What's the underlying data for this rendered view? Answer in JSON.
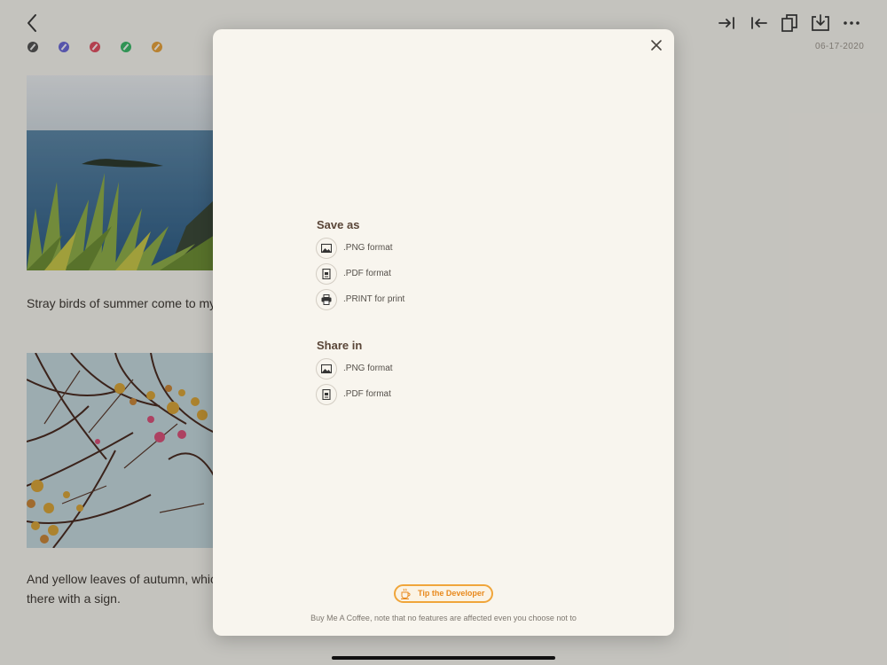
{
  "editor": {
    "date": "06-17-2020",
    "toolbar": {
      "icons": [
        "back-arrow-icon",
        "indent-in-icon",
        "indent-out-icon",
        "copy-icon",
        "download-icon",
        "more-icon"
      ]
    },
    "color_tags": [
      "#555555",
      "#6c6ad6",
      "#e05062",
      "#3cb86a",
      "#e6a23c"
    ],
    "paragraphs": [
      "Stray birds of summer come to my",
      "And yellow leaves of autumn, which",
      "there with a sign."
    ]
  },
  "sheet": {
    "save_title": "Save as",
    "save_options": [
      {
        "label": ".PNG format",
        "icon": "image-icon"
      },
      {
        "label": ".PDF format",
        "icon": "document-icon"
      },
      {
        "label": ".PRINT for print",
        "icon": "printer-icon"
      }
    ],
    "share_title": "Share in",
    "share_options": [
      {
        "label": ".PNG format",
        "icon": "image-icon"
      },
      {
        "label": ".PDF format",
        "icon": "document-icon"
      }
    ],
    "tip_label": "Tip the Developer",
    "tip_icon": "coffee-cup-icon",
    "tip_note": "Buy Me A Coffee, note that no features are affected even you choose not to"
  }
}
